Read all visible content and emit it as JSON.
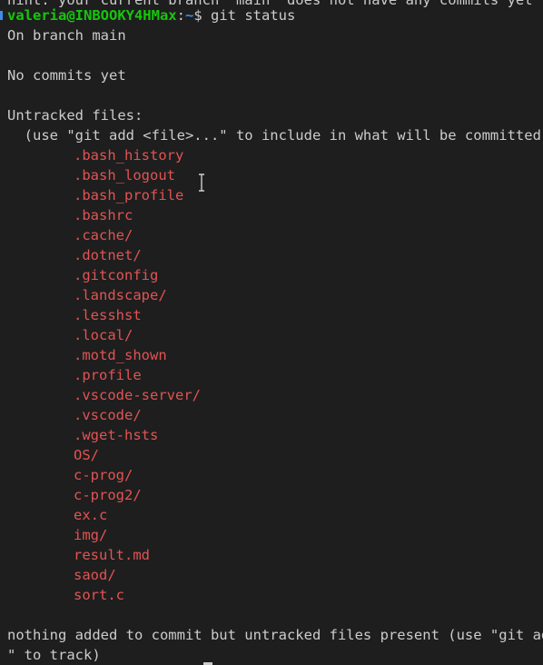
{
  "terminal": {
    "top_clipped_text": "hint: your current branch 'main' does not have any commits yet",
    "prompt": {
      "user_host": "valeria@INBOOKY4HMax",
      "colon": ":",
      "path": "~",
      "dollar": "$ ",
      "command": "git status"
    },
    "on_branch": "On branch main",
    "no_commits": "No commits yet",
    "untracked_header": "Untracked files:",
    "untracked_hint": "  (use \"git add <file>...\" to include in what will be committed)",
    "files": [
      ".bash_history",
      ".bash_logout",
      ".bash_profile",
      ".bashrc",
      ".cache/",
      ".dotnet/",
      ".gitconfig",
      ".landscape/",
      ".lesshst",
      ".local/",
      ".motd_shown",
      ".profile",
      ".vscode-server/",
      ".vscode/",
      ".wget-hsts",
      "OS/",
      "c-prog/",
      "c-prog2/",
      "ex.c",
      "img/",
      "result.md",
      "saod/",
      "sort.c"
    ],
    "summary_line1": "nothing added to commit but untracked files present (use \"git add",
    "summary_line2": "\" to track)",
    "colors": {
      "background": "#1e1e1e",
      "foreground": "#cccccc",
      "user_host": "#16c60c",
      "path": "#3b8eea",
      "untracked_file": "#e35353"
    }
  }
}
